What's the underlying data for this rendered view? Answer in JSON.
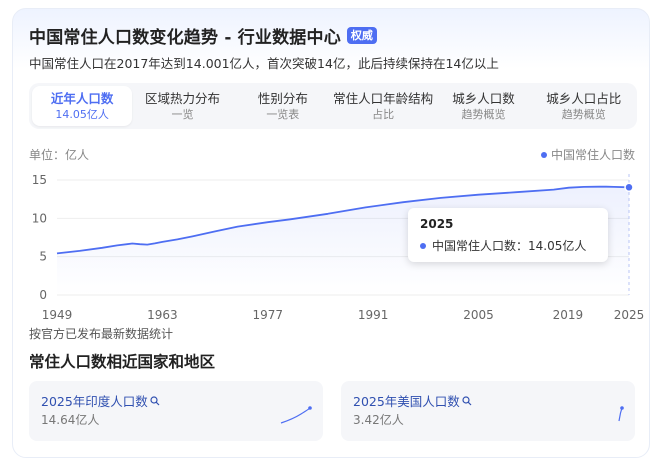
{
  "header": {
    "title": "中国常住人口数变化趋势 - 行业数据中心",
    "badge": "权威",
    "subtitle": "中国常住人口在2017年达到14.001亿人，首次突破14亿，此后持续保持在14亿以上"
  },
  "tabs": [
    {
      "label": "近年人口数",
      "sub": "14.05亿人",
      "active": true
    },
    {
      "label": "区域热力分布",
      "sub": "一览"
    },
    {
      "label": "性别分布",
      "sub": "一览表"
    },
    {
      "label": "常住人口年龄结构",
      "sub": "占比"
    },
    {
      "label": "城乡人口数",
      "sub": "趋势概览"
    },
    {
      "label": "城乡人口占比",
      "sub": "趋势概览"
    }
  ],
  "chart_unit": "单位：亿人",
  "legend_label": "中国常住人口数",
  "tooltip": {
    "year": "2025",
    "label": "中国常住人口数：14.05亿人"
  },
  "note": "按官方已发布最新数据统计",
  "section_title": "常住人口数相近国家和地区",
  "related": [
    {
      "title": "2025年印度人口数",
      "value": "14.64亿人"
    },
    {
      "title": "2025年美国人口数",
      "value": "3.42亿人"
    }
  ],
  "colors": {
    "accent": "#4e6ef2"
  },
  "chart_data": {
    "type": "line",
    "title": "",
    "xlabel": "",
    "ylabel": "单位：亿人",
    "series": [
      {
        "name": "中国常住人口数",
        "x": [
          1949,
          1952,
          1955,
          1957,
          1959,
          1960,
          1961,
          1962,
          1963,
          1965,
          1967,
          1970,
          1973,
          1977,
          1980,
          1985,
          1990,
          1995,
          2000,
          2005,
          2010,
          2015,
          2017,
          2019,
          2021,
          2022,
          2023,
          2025
        ],
        "values": [
          5.42,
          5.75,
          6.15,
          6.47,
          6.72,
          6.62,
          6.58,
          6.73,
          6.92,
          7.25,
          7.64,
          8.3,
          8.92,
          9.5,
          9.87,
          10.59,
          11.43,
          12.11,
          12.67,
          13.08,
          13.41,
          13.75,
          14.0,
          14.1,
          14.13,
          14.12,
          14.1,
          14.05
        ]
      }
    ],
    "xticks": [
      1949,
      1963,
      1977,
      1991,
      2005,
      2019,
      2025
    ],
    "yticks": [
      0,
      5,
      10,
      15
    ],
    "xlim": [
      1949,
      2025
    ],
    "ylim": [
      0,
      15
    ],
    "grid": true,
    "legend": "top-right"
  }
}
